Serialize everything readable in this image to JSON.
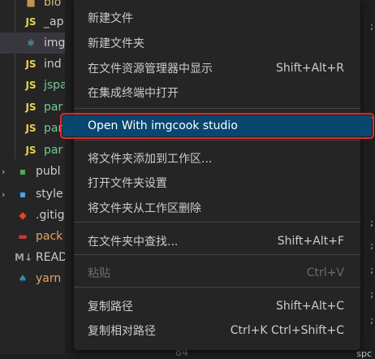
{
  "explorer": {
    "items": [
      {
        "label": "blo",
        "icon": "folder-icon",
        "icon_glyph": "■",
        "color": "#c09553",
        "text_color": "#d7ba7d"
      },
      {
        "label": "_ap",
        "icon": "js-file-icon",
        "icon_glyph": "JS",
        "color": "#e8d44d",
        "text_color": "#cccccc"
      },
      {
        "label": "img",
        "icon": "react-file-icon",
        "icon_glyph": "⚛",
        "color": "#61dafb",
        "text_color": "#cccccc"
      },
      {
        "label": "ind",
        "icon": "js-file-icon",
        "icon_glyph": "JS",
        "color": "#e8d44d",
        "text_color": "#cccccc"
      },
      {
        "label": "jspa",
        "icon": "js-file-icon",
        "icon_glyph": "JS",
        "color": "#e8d44d",
        "text_color": "#73c991"
      },
      {
        "label": "par",
        "icon": "js-file-icon",
        "icon_glyph": "JS",
        "color": "#e8d44d",
        "text_color": "#73c991"
      },
      {
        "label": "par",
        "icon": "js-file-icon",
        "icon_glyph": "JS",
        "color": "#e8d44d",
        "text_color": "#73c991"
      },
      {
        "label": "par",
        "icon": "js-file-icon",
        "icon_glyph": "JS",
        "color": "#e8d44d",
        "text_color": "#73c991"
      },
      {
        "label": "publ",
        "icon": "folder-public-icon",
        "icon_glyph": "▪",
        "color": "#4caf50",
        "text_color": "#cccccc"
      },
      {
        "label": "style",
        "icon": "folder-styles-icon",
        "icon_glyph": "▪",
        "color": "#42a5f5",
        "text_color": "#cccccc"
      },
      {
        "label": ".gitig",
        "icon": "git-icon",
        "icon_glyph": "◆",
        "color": "#e64a19",
        "text_color": "#cccccc"
      },
      {
        "label": "pack",
        "icon": "npm-icon",
        "icon_glyph": "▬",
        "color": "#cb3837",
        "text_color": "#e2a560"
      },
      {
        "label": "READ",
        "icon": "markdown-icon",
        "icon_glyph": "M↓",
        "color": "#9e9e9e",
        "text_color": "#cccccc"
      },
      {
        "label": "yarn",
        "icon": "yarn-icon",
        "icon_glyph": "♠",
        "color": "#2c8ebb",
        "text_color": "#e2a560"
      }
    ]
  },
  "editor": {
    "line_number": "84",
    "edge_text": "spc"
  },
  "menu": {
    "groups": [
      [
        {
          "id": "new-file",
          "label": "新建文件",
          "shortcut": ""
        },
        {
          "id": "new-folder",
          "label": "新建文件夹",
          "shortcut": ""
        },
        {
          "id": "reveal-in-explorer",
          "label": "在文件资源管理器中显示",
          "shortcut": "Shift+Alt+R"
        },
        {
          "id": "open-in-terminal",
          "label": "在集成终端中打开",
          "shortcut": ""
        }
      ],
      [
        {
          "id": "open-with-imgcook",
          "label": "Open With imgcook studio",
          "shortcut": "",
          "highlight": true
        }
      ],
      [
        {
          "id": "add-folder-to-workspace",
          "label": "将文件夹添加到工作区...",
          "shortcut": ""
        },
        {
          "id": "open-folder-settings",
          "label": "打开文件夹设置",
          "shortcut": ""
        },
        {
          "id": "remove-folder-from-workspace",
          "label": "将文件夹从工作区删除",
          "shortcut": ""
        }
      ],
      [
        {
          "id": "find-in-folder",
          "label": "在文件夹中查找...",
          "shortcut": "Shift+Alt+F"
        }
      ],
      [
        {
          "id": "paste",
          "label": "粘贴",
          "shortcut": "Ctrl+V",
          "disabled": true
        }
      ],
      [
        {
          "id": "copy-path",
          "label": "复制路径",
          "shortcut": "Shift+Alt+C"
        },
        {
          "id": "copy-relative-path",
          "label": "复制相对路径",
          "shortcut": "Ctrl+K Ctrl+Shift+C"
        }
      ]
    ]
  }
}
